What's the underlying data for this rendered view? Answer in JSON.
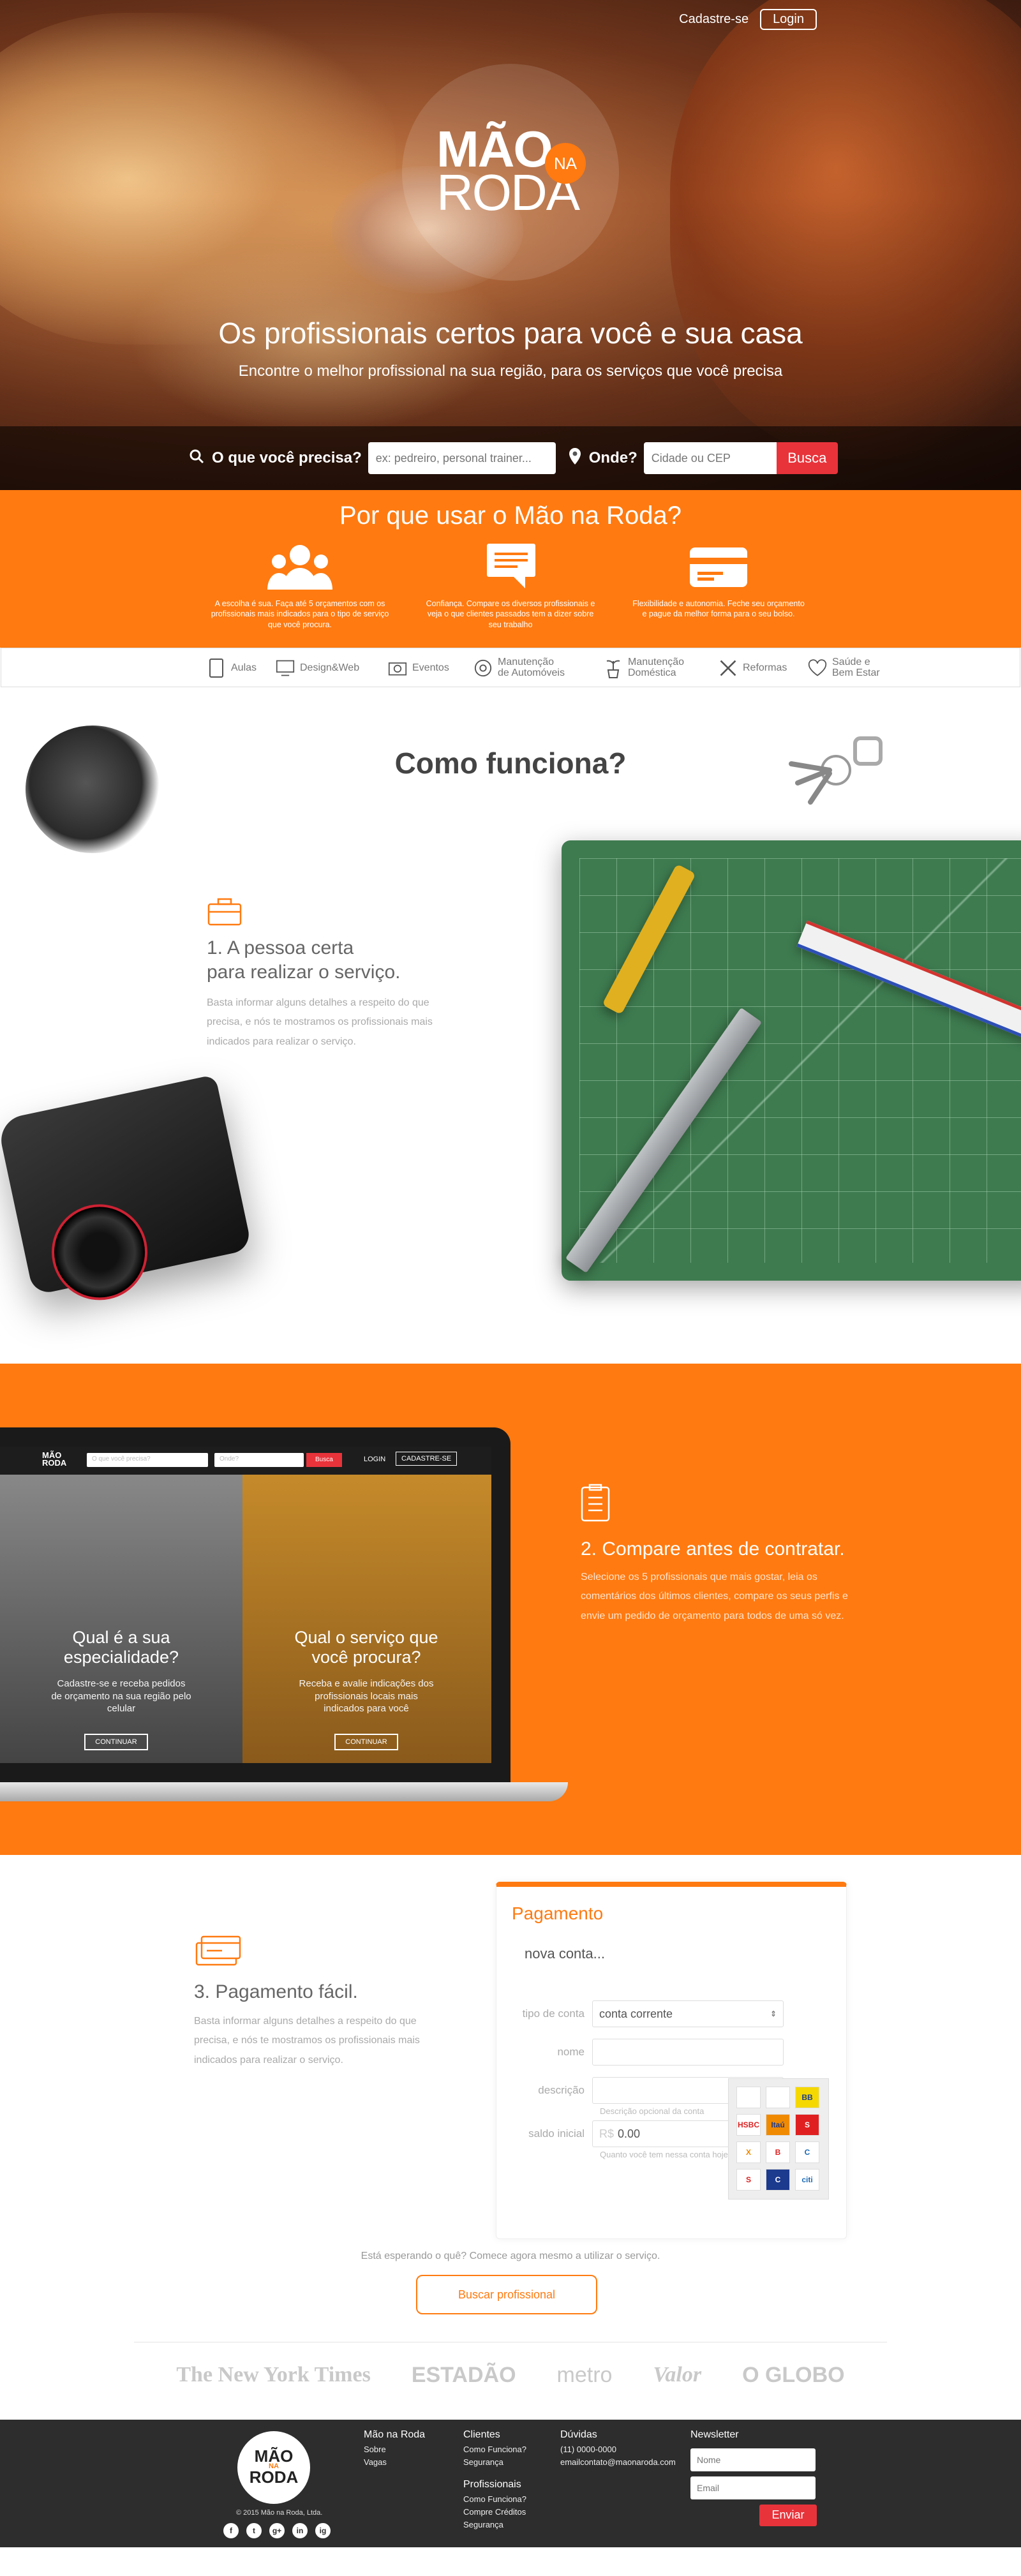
{
  "header": {
    "signup": "Cadastre-se",
    "login": "Login",
    "logo_line1": "MÃO",
    "logo_na": "NA",
    "logo_line2": "RODA",
    "headline": "Os profissionais certos para você e sua casa",
    "subheadline": "Encontre o melhor profissional na sua região, para os serviços que você precisa"
  },
  "search": {
    "what_label": "O que você precisa?",
    "what_placeholder": "ex: pedreiro, personal trainer...",
    "where_label": "Onde?",
    "where_placeholder": "Cidade ou CEP",
    "button": "Busca"
  },
  "why": {
    "title": "Por que usar o Mão na Roda?",
    "features": [
      {
        "icon": "people-icon",
        "text": "A escolha é sua. Faça até 5 orçamentos com os profissionais mais indicados para o tipo de serviço que você procura."
      },
      {
        "icon": "chat-icon",
        "text": "Confiança. Compare os diversos profissionais e veja o que clientes passados tem a dizer sobre seu trabalho"
      },
      {
        "icon": "credit-card-icon",
        "text": "Flexibilidade e autonomia. Feche seu orçamento e pague da melhor forma para o seu bolso."
      }
    ]
  },
  "categories": [
    {
      "icon": "tablet-icon",
      "label": "Aulas"
    },
    {
      "icon": "monitor-icon",
      "label": "Design&Web"
    },
    {
      "icon": "camera-icon",
      "label": "Eventos"
    },
    {
      "icon": "gear-icon",
      "label": "Manutenção de Automóveis"
    },
    {
      "icon": "plant-icon",
      "label": "Manutenção Doméstica"
    },
    {
      "icon": "tools-icon",
      "label": "Reformas"
    },
    {
      "icon": "heart-icon",
      "label": "Saúde e Bem Estar"
    }
  ],
  "how": {
    "title": "Como funciona?",
    "step1": {
      "title_line1": "1.  A pessoa certa",
      "title_line2": "para realizar o serviço.",
      "text": "Basta informar alguns detalhes a respeito do que precisa, e nós te mostramos os profissionais mais indicados para realizar o serviço."
    }
  },
  "compare": {
    "title": "2. Compare antes de contratar.",
    "text": "Selecione os 5 profissionais que mais gostar, leia os comentários dos últimos clientes, compare os seus perfis e envie um pedido de orçamento para todos de uma só vez.",
    "laptop": {
      "search_placeholder": "O que você precisa?",
      "where_placeholder": "Onde?",
      "search_btn": "Busca",
      "login": "LOGIN",
      "signup": "CADASTRE-SE",
      "left_title": "Qual é a sua especialidade?",
      "left_text": "Cadastre-se e receba pedidos de orçamento na sua região pelo celular",
      "left_btn": "CONTINUAR",
      "right_title": "Qual o serviço que você procura?",
      "right_text": "Receba e avalie indicações dos profissionais locais mais indicados para você",
      "right_btn": "CONTINUAR"
    }
  },
  "payment": {
    "title": "3. Pagamento fácil.",
    "text": "Basta informar alguns detalhes a respeito do que precisa, e nós te mostramos os profissionais mais indicados para realizar o serviço.",
    "panel": {
      "title": "Pagamento",
      "name": "nova conta...",
      "type_label": "tipo de conta",
      "type_value": "conta corrente",
      "name_label": "nome",
      "desc_label": "descrição",
      "desc_hint": "Descrição opcional da conta",
      "balance_label": "saldo inicial",
      "balance_currency": "R$",
      "balance_value": "0.00",
      "balance_hint": "Quanto você tem nessa conta hoje?",
      "banks": [
        "",
        "",
        "BB",
        "HSBC",
        "Itaú",
        "S",
        "X",
        "B",
        "C",
        "S",
        "C",
        "citi"
      ]
    }
  },
  "cta": {
    "text": "Está esperando o quê? Comece agora mesmo a utilizar o serviço.",
    "button": "Buscar profissional"
  },
  "press": [
    "The New York Times",
    "ESTADÃO",
    "metro",
    "Valor",
    "O GLOBO"
  ],
  "footer": {
    "logo_line1": "MÃO",
    "logo_na": "NA",
    "logo_line2": "RODA",
    "copyright": "© 2015 Mão na Roda, Ltda.",
    "col1": {
      "title": "Mão na Roda",
      "items": [
        "Sobre",
        "Vagas"
      ]
    },
    "col2": {
      "title": "Clientes",
      "items": [
        "Como Funciona?",
        "Segurança"
      ]
    },
    "col2b": {
      "title": "Profissionais",
      "items": [
        "Como Funciona?",
        "Compre Créditos",
        "Segurança"
      ]
    },
    "col3": {
      "title": "Dúvidas",
      "items": [
        "(11) 0000-0000",
        "emailcontato@maonaroda.com"
      ]
    },
    "newsletter": {
      "title": "Newsletter",
      "name_placeholder": "Nome",
      "email_placeholder": "Email",
      "button": "Enviar"
    },
    "socials": [
      "f",
      "t",
      "g+",
      "in",
      "ig"
    ]
  }
}
